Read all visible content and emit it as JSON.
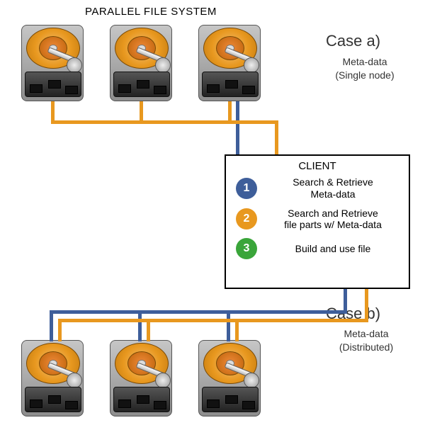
{
  "diagram": {
    "title": "PARALLEL FILE SYSTEM",
    "case_a": {
      "heading": "Case a)",
      "sub1": "Meta-data",
      "sub2": "(Single node)"
    },
    "case_b": {
      "heading": "Case b)",
      "sub1": "Meta-data",
      "sub2": "(Distributed)"
    },
    "client": {
      "title": "CLIENT",
      "steps": [
        {
          "n": "1",
          "text": "Search & Retrieve\nMeta-data",
          "color": "blue"
        },
        {
          "n": "2",
          "text": "Search and Retrieve\nfile parts w/ Meta-data",
          "color": "orange"
        },
        {
          "n": "3",
          "text": "Build and use file",
          "color": "green"
        }
      ]
    },
    "nodes": {
      "top_disks": 3,
      "bottom_disks": 3
    },
    "colors": {
      "blue": "#3e5e9a",
      "orange": "#e8981f",
      "green": "#3aa53a"
    }
  }
}
